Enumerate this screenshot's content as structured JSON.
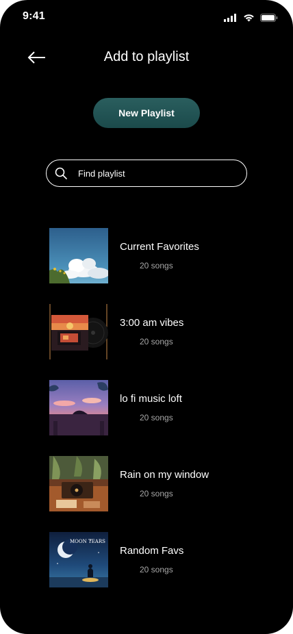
{
  "status_bar": {
    "time": "9:41",
    "icons": [
      "signal-icon",
      "wifi-icon",
      "battery-icon"
    ]
  },
  "header": {
    "back_icon": "arrow-left-icon",
    "title": "Add to playlist"
  },
  "new_playlist_button": {
    "label": "New Playlist",
    "color": "#1f5253"
  },
  "search": {
    "placeholder": "Find playlist",
    "icon": "search-icon"
  },
  "playlists": [
    {
      "name": "Current Favorites",
      "count": "20 songs"
    },
    {
      "name": "3:00 am vibes",
      "count": "20 songs"
    },
    {
      "name": "lo fi music loft",
      "count": "20 songs"
    },
    {
      "name": "Rain on my window",
      "count": "20 songs"
    },
    {
      "name": "Random Favs",
      "count": "20 songs",
      "cover_text": "MOON TEARS"
    }
  ],
  "colors": {
    "background": "#000000",
    "text": "#ffffff",
    "secondary_text": "#a8a8a8",
    "accent": "#1f5253"
  }
}
